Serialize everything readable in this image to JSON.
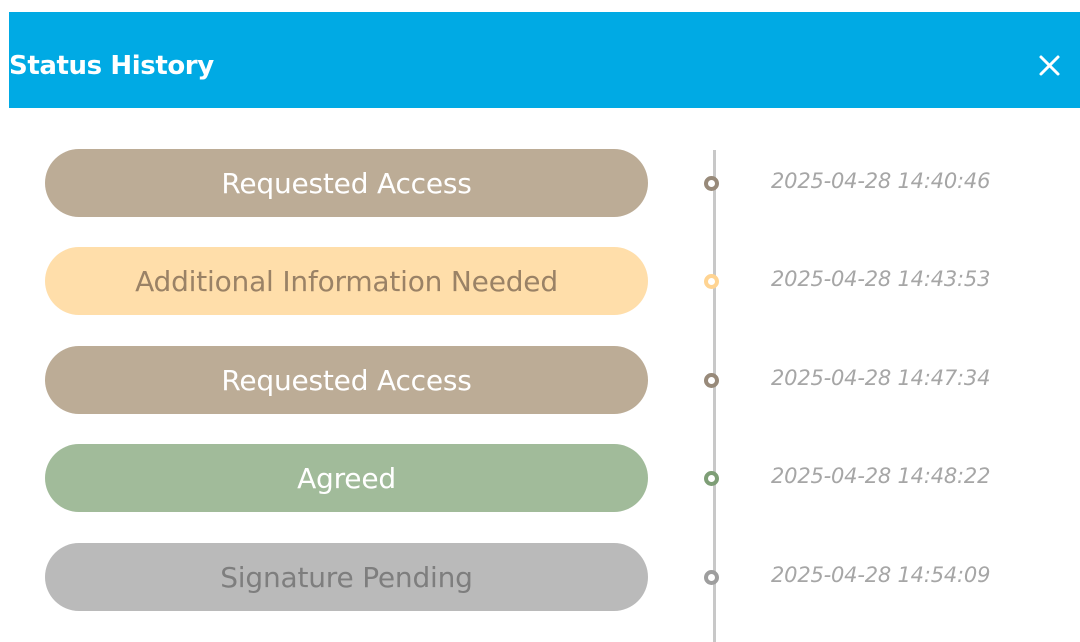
{
  "dialog": {
    "title": "Status History",
    "close_label": "×",
    "close_icon": "close-icon"
  },
  "theme": {
    "header_bg": "#00aae4",
    "timeline_color": "#c8c8c8"
  },
  "history": [
    {
      "status": "Requested Access",
      "timestamp": "2025-04-28 14:40:46",
      "pill_bg": "#bcac96",
      "text_color": "#ffffff",
      "dot_color": "#988a7a"
    },
    {
      "status": "Additional Information Needed",
      "timestamp": "2025-04-28 14:43:53",
      "pill_bg": "#ffdeaa",
      "text_color": "#9a8266",
      "dot_color": "#ffd492"
    },
    {
      "status": "Requested Access",
      "timestamp": "2025-04-28 14:47:34",
      "pill_bg": "#bcac96",
      "text_color": "#ffffff",
      "dot_color": "#988a7a"
    },
    {
      "status": "Agreed",
      "timestamp": "2025-04-28 14:48:22",
      "pill_bg": "#a1bb9a",
      "text_color": "#ffffff",
      "dot_color": "#7e9e76"
    },
    {
      "status": "Signature Pending",
      "timestamp": "2025-04-28 14:54:09",
      "pill_bg": "#bababa",
      "text_color": "#7e7e7e",
      "dot_color": "#9e9e9e"
    }
  ]
}
